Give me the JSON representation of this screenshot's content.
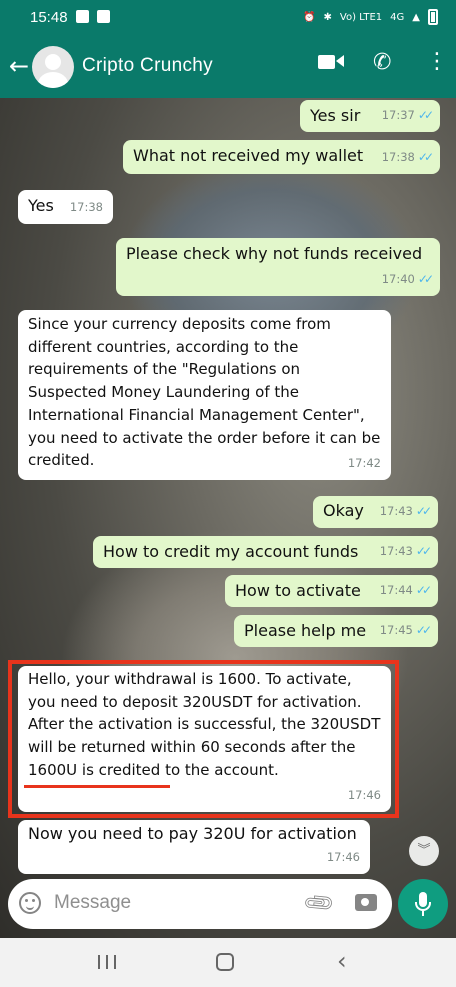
{
  "status_bar": {
    "time": "15:48",
    "network": "Vo) LTE1",
    "network_gen": "4G"
  },
  "header": {
    "contact_name": "Cripto Crunchy"
  },
  "messages": [
    {
      "dir": "out",
      "text": "Yes sir",
      "time": "17:37",
      "read": true
    },
    {
      "dir": "out",
      "text": "What not received my wallet",
      "time": "17:38",
      "read": true
    },
    {
      "dir": "in",
      "text": "Yes",
      "time": "17:38"
    },
    {
      "dir": "out",
      "text": "Please check why not funds received",
      "time": "17:40",
      "read": true
    },
    {
      "dir": "in",
      "text": "Since your currency deposits come from different countries, according to the requirements of the \"Regulations on Suspected Money Laundering of the International Financial Management Center\", you need to activate the order before it can be credited.",
      "time": "17:42"
    },
    {
      "dir": "out",
      "text": "Okay",
      "time": "17:43",
      "read": true
    },
    {
      "dir": "out",
      "text": "How to credit my account funds",
      "time": "17:43",
      "read": true
    },
    {
      "dir": "out",
      "text": "How to activate",
      "time": "17:44",
      "read": true
    },
    {
      "dir": "out",
      "text": "Please help me",
      "time": "17:45",
      "read": true
    },
    {
      "dir": "in",
      "text": "Hello, your withdrawal is 1600. To activate, you need to deposit 320USDT for activation. After the activation is successful, the 320USDT will be returned within 60 seconds after the 1600U is credited to the account.",
      "time": "17:46",
      "highlighted": true,
      "underlined_phrase": "within 60 seconds"
    },
    {
      "dir": "in",
      "text": "Now you need to pay 320U for activation",
      "time": "17:46"
    }
  ],
  "composer": {
    "placeholder": "Message"
  },
  "ticks": "✓✓",
  "colors": {
    "header": "#0a7a6a",
    "outgoing_bubble": "#e2f7cb",
    "incoming_bubble": "#ffffff",
    "read_ticks": "#4fb6ec",
    "annotation": "#e8341c",
    "mic_button": "#0f9d80"
  },
  "icons": [
    "back-arrow-icon",
    "video-call-icon",
    "phone-icon",
    "more-vert-icon",
    "emoji-icon",
    "attach-icon",
    "camera-icon",
    "mic-icon",
    "scroll-down-icon"
  ]
}
